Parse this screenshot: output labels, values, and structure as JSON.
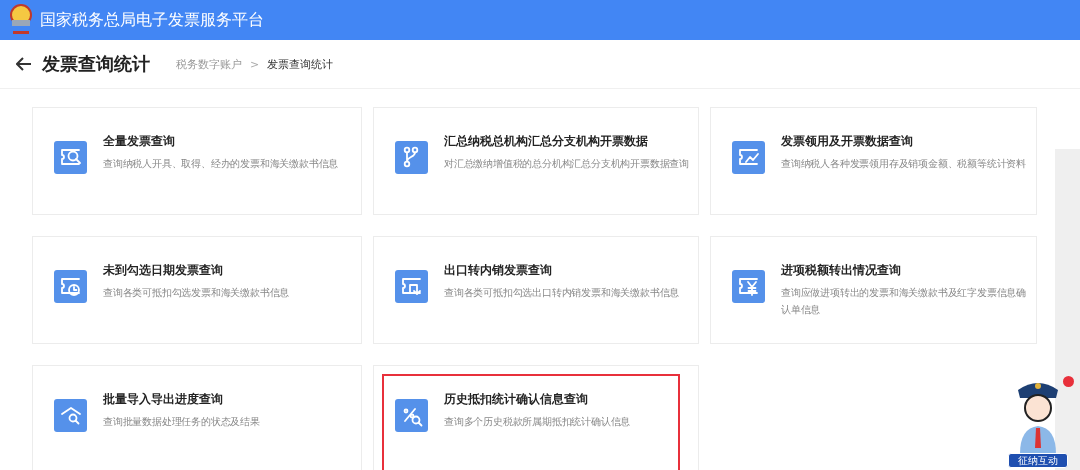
{
  "header": {
    "title": "国家税务总局电子发票服务平台"
  },
  "page": {
    "title": "发票查询统计",
    "breadcrumb": [
      {
        "label": "税务数字账户",
        "current": false
      },
      {
        "label": "发票查询统计",
        "current": true
      }
    ],
    "separator": ">"
  },
  "cards": [
    {
      "kind": "search",
      "title": "全量发票查询",
      "description": "查询纳税人开具、取得、经办的发票和海关缴款书信息",
      "highlighted": false
    },
    {
      "kind": "branch",
      "title": "汇总纳税总机构汇总分支机构开票数据",
      "description": "对汇总缴纳增值税的总分机构汇总分支机构开票数据查询",
      "highlighted": false
    },
    {
      "kind": "chart",
      "title": "发票领用及开票数据查询",
      "description": "查询纳税人各种发票领用存及销项金额、税额等统计资料",
      "highlighted": false
    },
    {
      "kind": "clock",
      "title": "未到勾选日期发票查询",
      "description": "查询各类可抵扣勾选发票和海关缴款书信息",
      "highlighted": false
    },
    {
      "kind": "return",
      "title": "出口转内销发票查询",
      "description": "查询各类可抵扣勾选出口转内销发票和海关缴款书信息",
      "highlighted": false
    },
    {
      "kind": "yen",
      "title": "进项税额转出情况查询",
      "description": "查询应做进项转出的发票和海关缴款书及红字发票信息确认单信息",
      "highlighted": false
    },
    {
      "kind": "import",
      "title": "批量导入导出进度查询",
      "description": "查询批量数据处理任务的状态及结果",
      "highlighted": false
    },
    {
      "kind": "percent",
      "title": "历史抵扣统计确认信息查询",
      "description": "查询多个历史税款所属期抵扣统计确认信息",
      "highlighted": true
    }
  ],
  "assistant": {
    "label": "征纳互动"
  }
}
